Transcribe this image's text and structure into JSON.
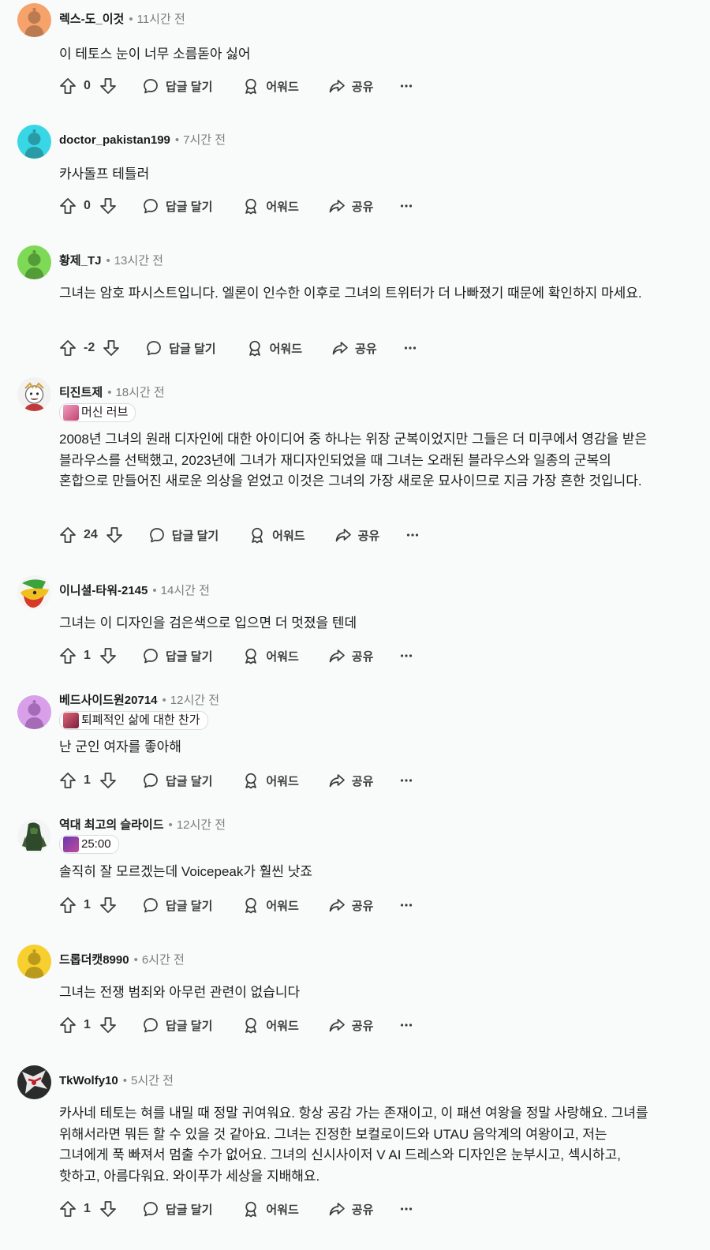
{
  "actions": {
    "reply": "답글 달기",
    "award": "어워드",
    "share": "공유"
  },
  "comments": [
    {
      "username": "렉스-도_이것",
      "time": "11시간 전",
      "avatar_color": "#f6a26b",
      "flair": null,
      "text": "이 테토스 눈이 너무 소름돋아 싫어",
      "score": "0"
    },
    {
      "username": "doctor_pakistan199",
      "time": "7시간 전",
      "avatar_color": "#38d7e6",
      "flair": null,
      "text": "카사돌프 테틀러",
      "score": "0"
    },
    {
      "username": "황제_TJ",
      "time": "13시간 전",
      "avatar_color": "#7ed957",
      "flair": null,
      "text": "그녀는 암호 파시스트입니다. 엘론이 인수한 이후로 그녀의 트위터가 더 나빠졌기 때문에 확인하지 마세요.",
      "score": "-2"
    },
    {
      "username": "티진트제",
      "time": "18시간 전",
      "avatar_color": "#e8e8e8",
      "flair": "머신 러브",
      "text": "2008년 그녀의 원래 디자인에 대한 아이디어 중 하나는 위장 군복이었지만 그들은 더 미쿠에서 영감을 받은 블라우스를 선택했고, 2023년에 그녀가 재디자인되었을 때 그녀는 오래된 블라우스와 일종의 군복의 혼합으로 만들어진 새로운 의상을 얻었고 이것은 그녀의 가장 새로운 묘사이므로 지금 가장 흔한 것입니다.",
      "score": "24"
    },
    {
      "username": "이니셜-타워-2145",
      "time": "14시간 전",
      "avatar_color": "#f0f0f0",
      "flair": null,
      "text": "그녀는 이 디자인을 검은색으로 입으면 더 멋졌을 텐데",
      "score": "1"
    },
    {
      "username": "베드사이드원20714",
      "time": "12시간 전",
      "avatar_color": "#d9a0ea",
      "flair": "퇴폐적인 삶에 대한 찬가",
      "text": "난 군인 여자를 좋아해",
      "score": "1"
    },
    {
      "username": "역대 최고의 슬라이드",
      "time": "12시간 전",
      "avatar_color": "#2f4a2a",
      "flair": "25:00",
      "text": "솔직히 잘 모르겠는데 Voicepeak가 훨씬 낫죠",
      "score": "1"
    },
    {
      "username": "드롭더캣8990",
      "time": "6시간 전",
      "avatar_color": "#f7cf2e",
      "flair": null,
      "text": "그녀는 전쟁 범죄와 아무런 관련이 없습니다",
      "score": "1"
    },
    {
      "username": "TkWolfy10",
      "time": "5시간 전",
      "avatar_color": "#2b2b2b",
      "flair": null,
      "text": "카사네 테토는 혀를 내밀 때 정말 귀여워요. 항상 공감 가는 존재이고, 이 패션 여왕을 정말 사랑해요. 그녀를 위해서라면 뭐든 할 수 있을 것 같아요. 그녀는 진정한 보컬로이드와 UTAU 음악계의 여왕이고, 저는 그녀에게 푹 빠져서 멈출 수가 없어요. 그녀의 신시사이저 V AI 드레스와 디자인은 눈부시고, 섹시하고, 핫하고, 아름다워요. 와이푸가 세상을 지배해요.",
      "score": "1"
    }
  ]
}
